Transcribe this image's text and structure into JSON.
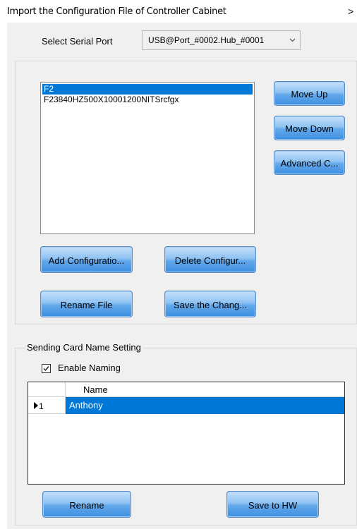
{
  "window": {
    "title": "Import the Configuration File of Controller Cabinet",
    "close_glyph": ">"
  },
  "serial_port": {
    "label": "Select Serial Port",
    "selected": "USB@Port_#0002.Hub_#0001"
  },
  "config_list": {
    "items": [
      {
        "label": "F2",
        "selected": true
      },
      {
        "label": "F23840HZ500X10001200NITSrcfgx",
        "selected": false
      }
    ]
  },
  "buttons": {
    "move_up": "Move Up",
    "move_down": "Move Down",
    "advanced": "Advanced C...",
    "add_config": "Add Configuratio...",
    "delete_config": "Delete Configur...",
    "rename_file": "Rename File",
    "save_changes": "Save the Chang...",
    "rename": "Rename",
    "save_to_hw": "Save to HW"
  },
  "sending_card": {
    "group_title": "Sending Card Name Setting",
    "enable_naming": {
      "label": "Enable Naming",
      "checked": true
    },
    "grid": {
      "column_header": "Name",
      "rows": [
        {
          "index": "1",
          "name": "Anthony",
          "selected": true
        }
      ]
    }
  },
  "colors": {
    "selection": "#0078d7",
    "panel_bg": "#f0f0f0",
    "button_gradient_top": "#c7e1fa",
    "button_gradient_bottom": "#3d8fe2"
  }
}
